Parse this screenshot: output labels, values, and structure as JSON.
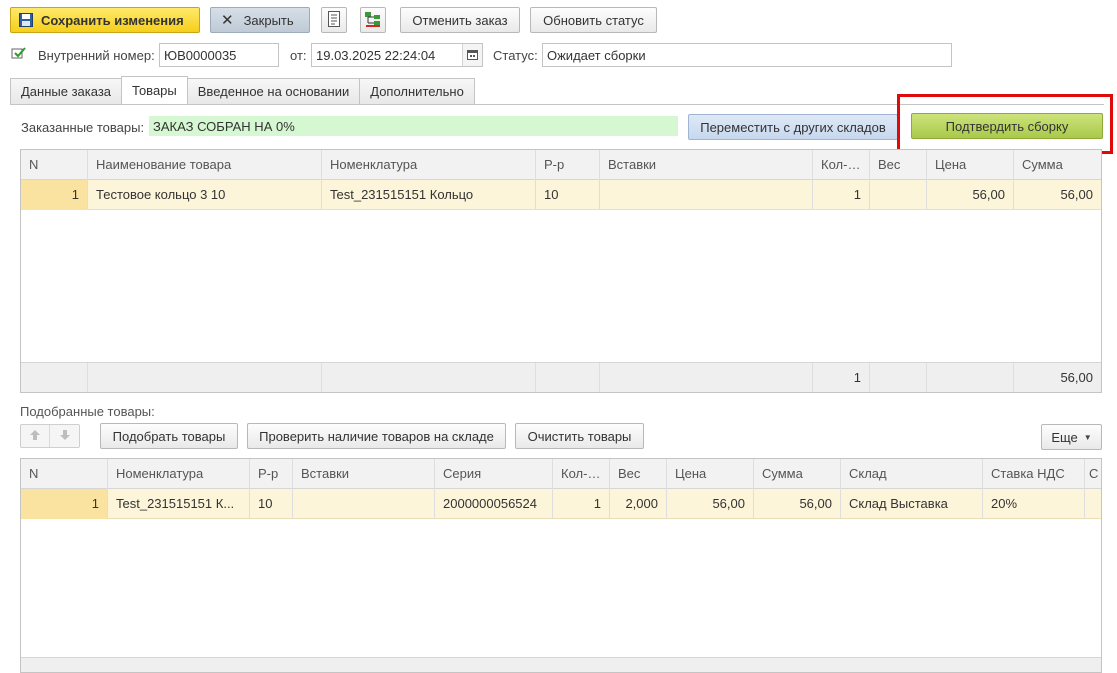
{
  "toolbar": {
    "save_label": "Сохранить изменения",
    "close_label": "Закрыть",
    "cancel_order_label": "Отменить заказ",
    "update_status_label": "Обновить статус"
  },
  "header": {
    "internal_number_label": "Внутренний номер:",
    "internal_number_value": "ЮВ0000035",
    "date_label": "от:",
    "date_value": "19.03.2025 22:24:04",
    "status_label": "Статус:",
    "status_value": "Ожидает сборки"
  },
  "tabs": [
    {
      "label": "Данные заказа"
    },
    {
      "label": "Товары"
    },
    {
      "label": "Введенное на основании"
    },
    {
      "label": "Дополнительно"
    }
  ],
  "ordered": {
    "label": "Заказанные товары:",
    "progress_text": "ЗАКАЗ СОБРАН НА 0%",
    "move_button": "Переместить с других складов",
    "confirm_button": "Подтвердить сборку",
    "columns": [
      "N",
      "Наименование товара",
      "Номенклатура",
      "Р-р",
      "Вставки",
      "Кол-во",
      "Вес",
      "Цена",
      "Сумма"
    ],
    "rows": [
      [
        "1",
        "Тестовое кольцо 3 10",
        "Test_231515151 Кольцо",
        "10",
        "",
        "1",
        "",
        "56,00",
        "56,00"
      ]
    ],
    "totals": {
      "qty": "1",
      "sum": "56,00"
    }
  },
  "picked": {
    "label": "Подобранные товары:",
    "pick_button": "Подобрать товары",
    "check_button": "Проверить наличие товаров на складе",
    "clear_button": "Очистить товары",
    "more_button": "Еще",
    "columns": [
      "N",
      "Номенклатура",
      "Р-р",
      "Вставки",
      "Серия",
      "Кол-во",
      "Вес",
      "Цена",
      "Сумма",
      "Склад",
      "Ставка НДС",
      "С"
    ],
    "rows": [
      [
        "1",
        "Test_231515151 К...",
        "10",
        "",
        "2000000056524",
        "1",
        "2,000",
        "56,00",
        "56,00",
        "Склад Выставка",
        "20%",
        ""
      ]
    ]
  },
  "colors": {
    "save_button": "#f5cf1a",
    "confirm_button": "#a9c94a",
    "progress_bg": "#d5f7d1",
    "row_highlight": "#fdf5d9",
    "annotation_box": "#e10a0a"
  }
}
